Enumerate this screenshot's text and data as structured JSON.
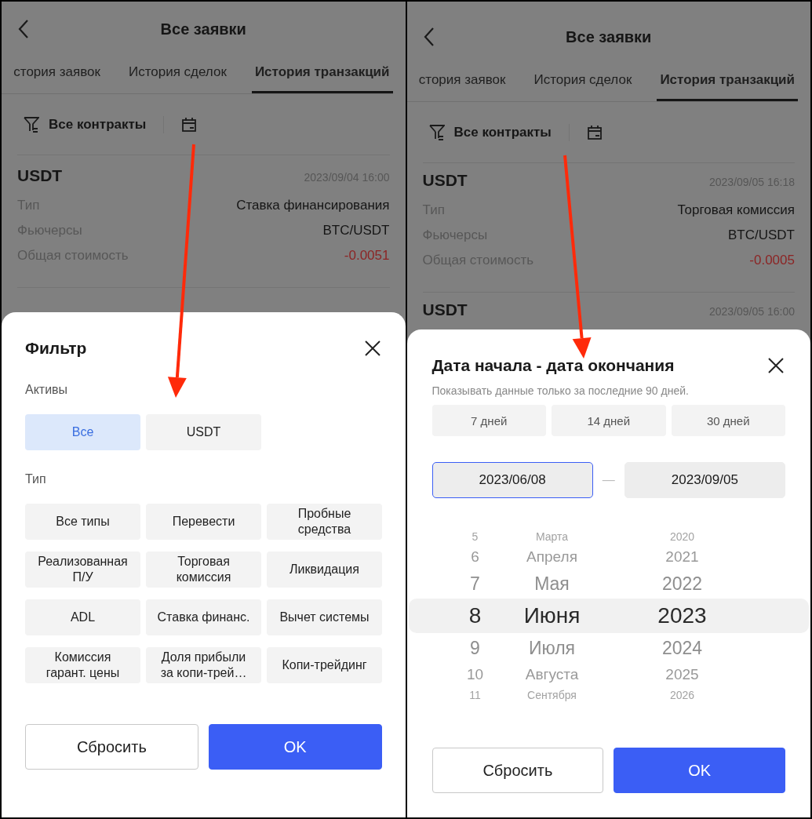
{
  "screens": [
    {
      "title": "Все заявки",
      "tabs": [
        {
          "label": "стория заявок",
          "selected": false
        },
        {
          "label": "История сделок",
          "selected": false
        },
        {
          "label": "История транзакций",
          "selected": true
        }
      ],
      "filter_label": "Все контракты",
      "records": [
        {
          "asset": "USDT",
          "time": "2023/09/04 16:00",
          "fields": [
            {
              "label": "Тип",
              "value": "Ставка финансирования",
              "negative": false
            },
            {
              "label": "Фьючерсы",
              "value": "BTC/USDT",
              "negative": false
            },
            {
              "label": "Общая стоимость",
              "value": "-0.0051",
              "negative": true
            }
          ]
        }
      ],
      "sheet": {
        "kind": "filter",
        "title": "Фильтр",
        "sections": [
          {
            "label": "Активы",
            "options": [
              {
                "label": "Все",
                "selected": true
              },
              {
                "label": "USDT",
                "selected": false
              }
            ]
          },
          {
            "label": "Тип",
            "options": [
              {
                "label": "Все типы",
                "selected": false
              },
              {
                "label": "Перевести",
                "selected": false
              },
              {
                "label": "Пробные средства",
                "selected": false
              },
              {
                "label": "Реализованная П/У",
                "selected": false
              },
              {
                "label": "Торговая комиссия",
                "selected": false
              },
              {
                "label": "Ликвидация",
                "selected": false
              },
              {
                "label": "ADL",
                "selected": false
              },
              {
                "label": "Ставка финанс.",
                "selected": false
              },
              {
                "label": "Вычет системы",
                "selected": false
              },
              {
                "label": "Комиссия гарант. цены",
                "selected": false
              },
              {
                "label": "Доля прибыли за копи-трей…",
                "selected": false
              },
              {
                "label": "Копи-трейдинг",
                "selected": false
              }
            ]
          }
        ],
        "buttons": [
          {
            "label": "Сбросить",
            "kind": "secondary"
          },
          {
            "label": "OK",
            "kind": "primary"
          }
        ]
      }
    },
    {
      "title": "Все заявки",
      "tabs": [
        {
          "label": "стория заявок",
          "selected": false
        },
        {
          "label": "История сделок",
          "selected": false
        },
        {
          "label": "История транзакций",
          "selected": true
        }
      ],
      "filter_label": "Все контракты",
      "records": [
        {
          "asset": "USDT",
          "time": "2023/09/05 16:18",
          "fields": [
            {
              "label": "Тип",
              "value": "Торговая комиссия",
              "negative": false
            },
            {
              "label": "Фьючерсы",
              "value": "BTC/USDT",
              "negative": false
            },
            {
              "label": "Общая стоимость",
              "value": "-0.0005",
              "negative": true
            }
          ]
        },
        {
          "asset": "USDT",
          "time": "2023/09/05 16:00"
        }
      ],
      "sheet": {
        "kind": "date_range",
        "title": "Дата начала - дата окончания",
        "note": "Показывать данные только за последние 90 дней.",
        "presets": [
          {
            "label": "7 дней",
            "selected": false
          },
          {
            "label": "14 дней",
            "selected": false
          },
          {
            "label": "30 дней",
            "selected": false
          }
        ],
        "start": {
          "value": "2023/06/08",
          "selected": true
        },
        "separator": "—",
        "end": {
          "value": "2023/09/05",
          "selected": false
        },
        "picker": [
          {
            "items": [
              {
                "label": "5",
                "selected": false
              },
              {
                "label": "6",
                "selected": false
              },
              {
                "label": "7",
                "selected": false
              },
              {
                "label": "8",
                "selected": true
              },
              {
                "label": "9",
                "selected": false
              },
              {
                "label": "10",
                "selected": false
              },
              {
                "label": "11",
                "selected": false
              }
            ]
          },
          {
            "items": [
              {
                "label": "Марта",
                "selected": false
              },
              {
                "label": "Апреля",
                "selected": false
              },
              {
                "label": "Мая",
                "selected": false
              },
              {
                "label": "Июня",
                "selected": true
              },
              {
                "label": "Июля",
                "selected": false
              },
              {
                "label": "Августа",
                "selected": false
              },
              {
                "label": "Сентября",
                "selected": false
              }
            ]
          },
          {
            "items": [
              {
                "label": "2020",
                "selected": false
              },
              {
                "label": "2021",
                "selected": false
              },
              {
                "label": "2022",
                "selected": false
              },
              {
                "label": "2023",
                "selected": true
              },
              {
                "label": "2024",
                "selected": false
              },
              {
                "label": "2025",
                "selected": false
              },
              {
                "label": "2026",
                "selected": false
              }
            ]
          }
        ],
        "buttons": [
          {
            "label": "Сбросить",
            "kind": "secondary"
          },
          {
            "label": "OK",
            "kind": "primary"
          }
        ]
      }
    }
  ]
}
